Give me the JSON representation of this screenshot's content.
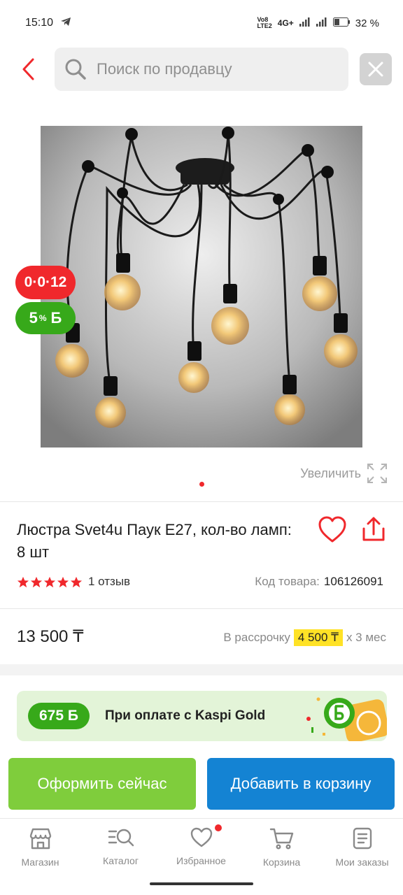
{
  "status_bar": {
    "time": "15:10",
    "volte_top": "Vo8",
    "volte_bottom": "LTE2",
    "network": "4G+",
    "battery": "32 %"
  },
  "search": {
    "placeholder": "Поиск по продавцу"
  },
  "product": {
    "badge_timer": "0·0·12",
    "badge_bonus_percent": "5",
    "badge_bonus_unit": "%",
    "bonus_currency_symbol": "Б",
    "zoom_label": "Увеличить",
    "title": "Люстра Svet4u Паук Е27, кол-во ламп: 8 шт",
    "rating_stars": 5,
    "reviews": "1 отзыв",
    "code_label": "Код товара:",
    "code_value": "106126091",
    "price": "13 500 ₸",
    "installment_prefix": "В рассрочку",
    "installment_amount": "4 500 ₸",
    "installment_suffix": "х 3 мес"
  },
  "gold_banner": {
    "bonus": "675 Б",
    "text": "При оплате с Kaspi Gold"
  },
  "actions": {
    "checkout": "Оформить сейчас",
    "add_to_cart": "Добавить в корзину"
  },
  "tabbar": {
    "items": [
      {
        "label": "Магазин",
        "icon": "shop-icon"
      },
      {
        "label": "Каталог",
        "icon": "catalog-search-icon"
      },
      {
        "label": "Избранное",
        "icon": "heart-icon"
      },
      {
        "label": "Корзина",
        "icon": "cart-icon"
      },
      {
        "label": "Мои заказы",
        "icon": "orders-icon"
      }
    ]
  },
  "colors": {
    "accent_red": "#f0282c",
    "bonus_green": "#37a91a",
    "checkout_green": "#7fcd3c",
    "cart_blue": "#1483d3",
    "installment_yellow": "#ffe226"
  }
}
